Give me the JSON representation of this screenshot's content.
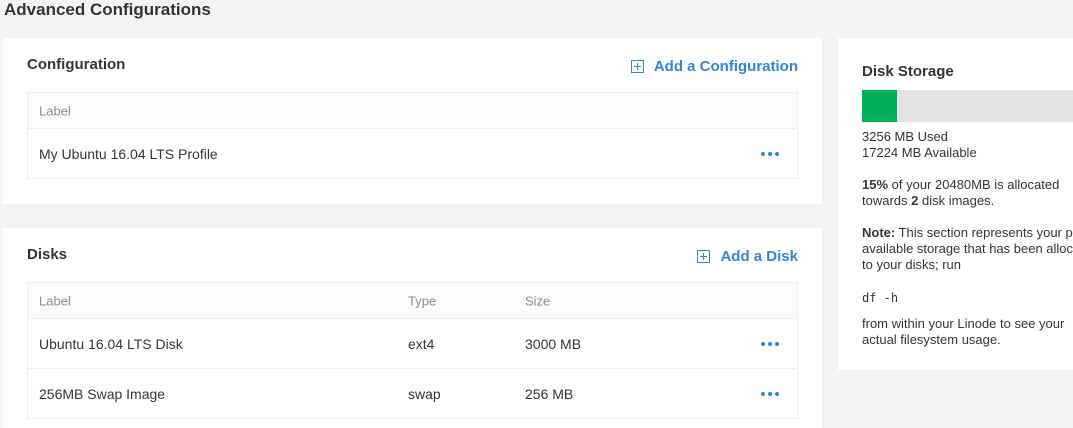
{
  "page": {
    "title": "Advanced Configurations"
  },
  "config": {
    "title": "Configuration",
    "add_label": "Add a Configuration",
    "headers": {
      "label": "Label"
    },
    "rows": [
      {
        "label": "My Ubuntu 16.04 LTS Profile"
      }
    ]
  },
  "disks": {
    "title": "Disks",
    "add_label": "Add a Disk",
    "headers": {
      "label": "Label",
      "type": "Type",
      "size": "Size"
    },
    "rows": [
      {
        "label": "Ubuntu 16.04 LTS Disk",
        "type": "ext4",
        "size": "3000 MB"
      },
      {
        "label": "256MB Swap Image",
        "type": "swap",
        "size": "256 MB"
      }
    ]
  },
  "storage": {
    "title": "Disk Storage",
    "used_fraction": 0.15,
    "bar_color": "#00b159",
    "used": "3256 MB Used",
    "available": "17224 MB Available",
    "percent": "15%",
    "allocated_mid": " of your 20480MB is allocated towards ",
    "image_count": "2",
    "allocated_end": " disk images.",
    "note_label": "Note:",
    "note_text": " This section represents your plan's available storage that has been allocated to your disks; run",
    "command": "df -h",
    "after_command": "from within your Linode to see your actual filesystem usage."
  },
  "icons": {
    "add": "plus-square-icon",
    "actions": "more-dots-icon"
  },
  "colors": {
    "accent": "#3683dc",
    "storage_used": "#00b159"
  }
}
